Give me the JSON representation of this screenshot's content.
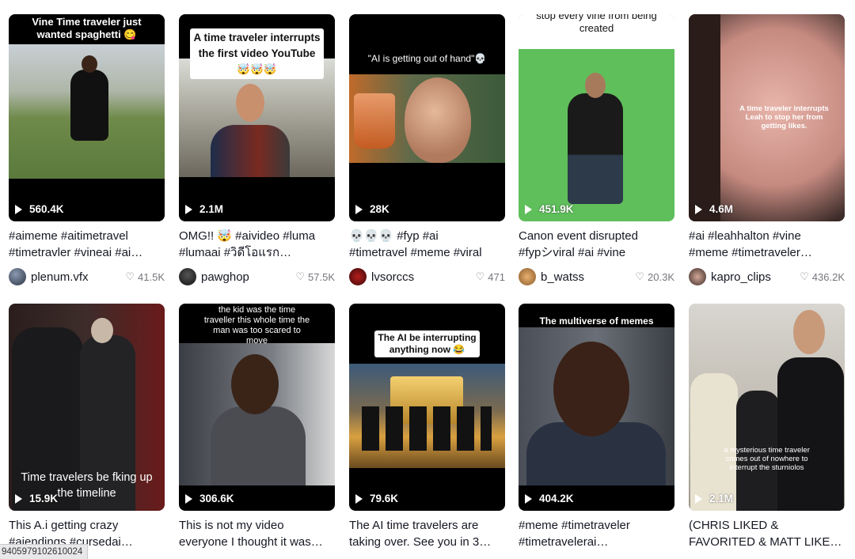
{
  "videos": [
    {
      "overlay": "Vine Time traveler just wanted spaghetti 😋",
      "views": "560.4K",
      "caption_l1": "#aimeme #aitimetravel",
      "caption_l2": "#timetravler #vineai #ai…",
      "user": "plenum.vfx",
      "likes": "41.5K"
    },
    {
      "overlay": "A time traveler interrupts the first video YouTube 🤯🤯🤯",
      "views": "2.1M",
      "caption_l1": "OMG!! 🤯 #aivideo #luma",
      "caption_l2": "#lumaai #วิดีโอแรก…",
      "user": "pawghop",
      "likes": "57.5K"
    },
    {
      "overlay": "\"AI is getting out of hand\"💀",
      "views": "28K",
      "caption_l1": "💀💀💀 #fyp #ai",
      "caption_l2": "#timetravel #meme #viral",
      "user": "lvsorccs",
      "likes": "471"
    },
    {
      "overlay": "stop every vine from being created",
      "views": "451.9K",
      "caption_l1": "Canon event disrupted",
      "caption_l2": "#fypシviral #ai #vine",
      "user": "b_watss",
      "likes": "20.3K"
    },
    {
      "overlay": "A time traveler interrupts Leah to stop her from getting likes.",
      "views": "4.6M",
      "caption_l1": "#ai #leahhalton #vine",
      "caption_l2": "#meme #timetraveler…",
      "user": "kapro_clips",
      "likes": "436.2K"
    },
    {
      "overlay": "Time travelers be fking up the timeline",
      "views": "15.9K",
      "caption_l1": "This A.i getting crazy",
      "caption_l2": "#aiendings #cursedai…",
      "user": "",
      "likes": ""
    },
    {
      "overlay": "the kid was the time traveller this whole time the man was too scared to move",
      "views": "306.6K",
      "caption_l1": "This is not my video",
      "caption_l2": "everyone I thought it was…",
      "user": "",
      "likes": ""
    },
    {
      "overlay": "The AI be interrupting anything now 😂",
      "views": "79.6K",
      "caption_l1": "The AI time travelers are",
      "caption_l2": "taking over. See you in 3…",
      "user": "",
      "likes": ""
    },
    {
      "overlay": "The multiverse of memes",
      "views": "404.2K",
      "caption_l1": "#meme #timetraveler",
      "caption_l2": "#timetravelerai…",
      "user": "",
      "likes": ""
    },
    {
      "overlay": "a mysterious time traveler comes out of nowhere to interrupt the sturniolos",
      "views": "2.1M",
      "caption_l1": "(CHRIS LIKED &",
      "caption_l2": "FAVORITED & MATT LIKE…",
      "user": "",
      "likes": ""
    }
  ],
  "status_url": "9405979102610024",
  "colors": {
    "text": "#161823",
    "muted": "#8a8b91",
    "thumb_bg": "#000000",
    "green_screen": "#5fbf5b"
  }
}
